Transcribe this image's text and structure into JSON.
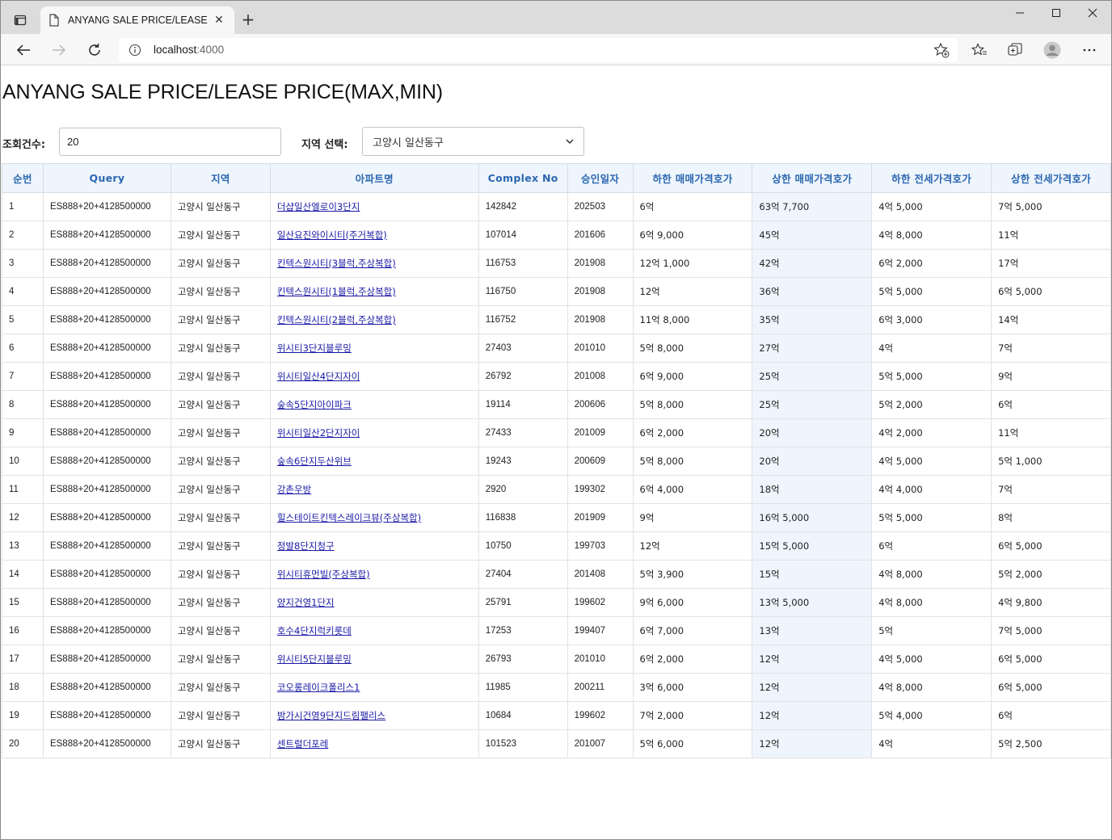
{
  "browser": {
    "tab_title": "ANYANG SALE PRICE/LEASE PRIC",
    "url_host": "localhost",
    "url_port": ":4000"
  },
  "page": {
    "title": "ANYANG SALE PRICE/LEASE PRICE(MAX,MIN)",
    "count_label": "조회건수:",
    "count_value": "20",
    "region_label": "지역 선택:",
    "region_selected": "고양시 일산동구"
  },
  "table": {
    "headers": [
      "순번",
      "Query",
      "지역",
      "아파트명",
      "Complex No",
      "승인일자",
      "하한 매매가격호가",
      "상한 매매가격호가",
      "하한 전세가격호가",
      "상한 전세가격호가"
    ],
    "rows": [
      [
        "1",
        "ES888+20+4128500000",
        "고양시 일산동구",
        "더샵일산엘로이3단지",
        "142842",
        "202503",
        "6억",
        "63억 7,700",
        "4억 5,000",
        "7억 5,000"
      ],
      [
        "2",
        "ES888+20+4128500000",
        "고양시 일산동구",
        "일산요진와이시티(주거복합)",
        "107014",
        "201606",
        "6억 9,000",
        "45억",
        "4억 8,000",
        "11억"
      ],
      [
        "3",
        "ES888+20+4128500000",
        "고양시 일산동구",
        "킨텍스원시티(3블럭,주상복합)",
        "116753",
        "201908",
        "12억 1,000",
        "42억",
        "6억 2,000",
        "17억"
      ],
      [
        "4",
        "ES888+20+4128500000",
        "고양시 일산동구",
        "킨텍스원시티(1블럭,주상복합)",
        "116750",
        "201908",
        "12억",
        "36억",
        "5억 5,000",
        "6억 5,000"
      ],
      [
        "5",
        "ES888+20+4128500000",
        "고양시 일산동구",
        "킨텍스원시티(2블럭,주상복합)",
        "116752",
        "201908",
        "11억 8,000",
        "35억",
        "6억 3,000",
        "14억"
      ],
      [
        "6",
        "ES888+20+4128500000",
        "고양시 일산동구",
        "위시티3단지블루밍",
        "27403",
        "201010",
        "5억 8,000",
        "27억",
        "4억",
        "7억"
      ],
      [
        "7",
        "ES888+20+4128500000",
        "고양시 일산동구",
        "위시티일산4단지자이",
        "26792",
        "201008",
        "6억 9,000",
        "25억",
        "5억 5,000",
        "9억"
      ],
      [
        "8",
        "ES888+20+4128500000",
        "고양시 일산동구",
        "숲속5단지아이파크",
        "19114",
        "200606",
        "5억 8,000",
        "25억",
        "5억 2,000",
        "6억"
      ],
      [
        "9",
        "ES888+20+4128500000",
        "고양시 일산동구",
        "위시티일산2단지자이",
        "27433",
        "201009",
        "6억 2,000",
        "20억",
        "4억 2,000",
        "11억"
      ],
      [
        "10",
        "ES888+20+4128500000",
        "고양시 일산동구",
        "숲속6단지두산위브",
        "19243",
        "200609",
        "5억 8,000",
        "20억",
        "4억 5,000",
        "5억 1,000"
      ],
      [
        "11",
        "ES888+20+4128500000",
        "고양시 일산동구",
        "강촌우방",
        "2920",
        "199302",
        "6억 4,000",
        "18억",
        "4억 4,000",
        "7억"
      ],
      [
        "12",
        "ES888+20+4128500000",
        "고양시 일산동구",
        "힐스테이트킨텍스레이크뷰(주상복합)",
        "116838",
        "201909",
        "9억",
        "16억 5,000",
        "5억 5,000",
        "8억"
      ],
      [
        "13",
        "ES888+20+4128500000",
        "고양시 일산동구",
        "정발8단지청구",
        "10750",
        "199703",
        "12억",
        "15억 5,000",
        "6억",
        "6억 5,000"
      ],
      [
        "14",
        "ES888+20+4128500000",
        "고양시 일산동구",
        "위시티휴먼빌(주상복합)",
        "27404",
        "201408",
        "5억 3,900",
        "15억",
        "4억 8,000",
        "5억 2,000"
      ],
      [
        "15",
        "ES888+20+4128500000",
        "고양시 일산동구",
        "양지건영1단지",
        "25791",
        "199602",
        "9억 6,000",
        "13억 5,000",
        "4억 8,000",
        "4억 9,800"
      ],
      [
        "16",
        "ES888+20+4128500000",
        "고양시 일산동구",
        "호수4단지럭키롯데",
        "17253",
        "199407",
        "6억 7,000",
        "13억",
        "5억",
        "7억 5,000"
      ],
      [
        "17",
        "ES888+20+4128500000",
        "고양시 일산동구",
        "위시티5단지블루밍",
        "26793",
        "201010",
        "6억 2,000",
        "12억",
        "4억 5,000",
        "6억 5,000"
      ],
      [
        "18",
        "ES888+20+4128500000",
        "고양시 일산동구",
        "코오롱레이크폴리스1",
        "11985",
        "200211",
        "3억 6,000",
        "12억",
        "4억 8,000",
        "6억 5,000"
      ],
      [
        "19",
        "ES888+20+4128500000",
        "고양시 일산동구",
        "밤가시건영9단지드림팰리스",
        "10684",
        "199602",
        "7억 2,000",
        "12억",
        "5억 4,000",
        "6억"
      ],
      [
        "20",
        "ES888+20+4128500000",
        "고양시 일산동구",
        "센트럴더포레",
        "101523",
        "201007",
        "5억 6,000",
        "12억",
        "4억",
        "5억 2,500"
      ]
    ]
  },
  "colors": {
    "header_bg": "#eef5fc",
    "header_text": "#2b67b0",
    "link": "#1a1aa6"
  }
}
